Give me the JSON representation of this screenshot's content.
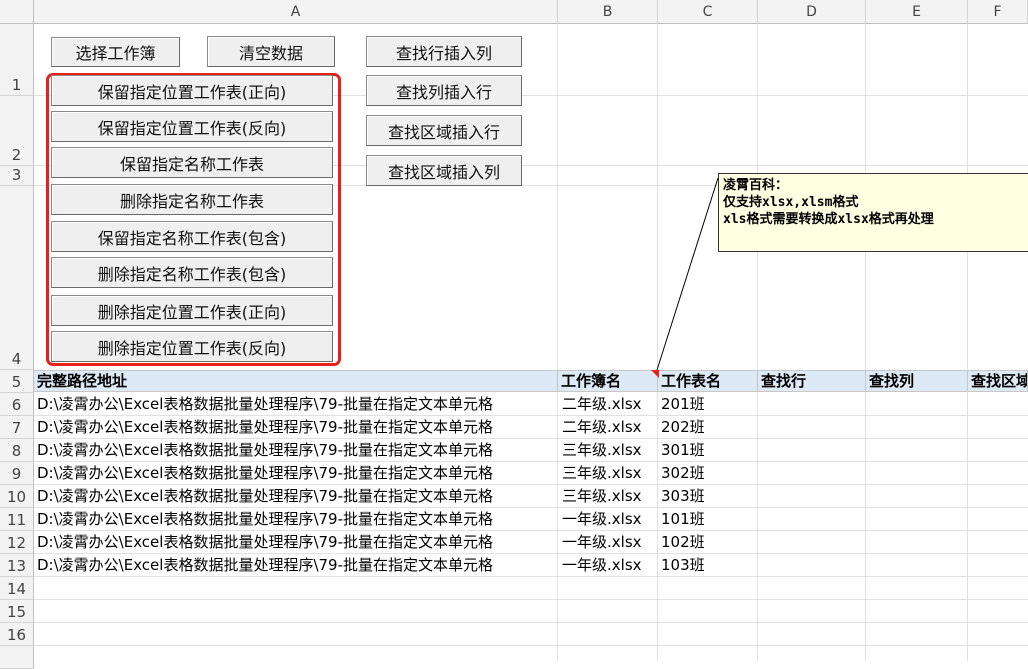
{
  "columns": [
    "A",
    "B",
    "C",
    "D",
    "E",
    "F"
  ],
  "rows": [
    "1",
    "2",
    "3",
    "4",
    "5",
    "6",
    "7",
    "8",
    "9",
    "10",
    "11",
    "12",
    "13",
    "14",
    "15",
    "16"
  ],
  "buttons": {
    "select_workbook": "选择工作簿",
    "clear_data": "清空数据",
    "find_row_insert_col": "查找行插入列",
    "find_col_insert_row": "查找列插入行",
    "find_area_insert_row": "查找区域插入行",
    "find_area_insert_col": "查找区域插入列",
    "group": [
      "保留指定位置工作表(正向)",
      "保留指定位置工作表(反向)",
      "保留指定名称工作表",
      "删除指定名称工作表",
      "保留指定名称工作表(包含)",
      "删除指定名称工作表(包含)",
      "删除指定位置工作表(正向)",
      "删除指定位置工作表(反向)"
    ]
  },
  "comment": {
    "line1": "凌霄百科：",
    "line2": "仅支持xlsx,xlsm格式",
    "line3": "xls格式需要转换成xlsx格式再处理"
  },
  "table": {
    "headers": [
      "完整路径地址",
      "工作簿名",
      "工作表名",
      "查找行",
      "查找列",
      "查找区域"
    ],
    "rows": [
      [
        "D:\\凌霄办公\\Excel表格数据批量处理程序\\79-批量在指定文本单元格",
        "二年级.xlsx",
        "201班"
      ],
      [
        "D:\\凌霄办公\\Excel表格数据批量处理程序\\79-批量在指定文本单元格",
        "二年级.xlsx",
        "202班"
      ],
      [
        "D:\\凌霄办公\\Excel表格数据批量处理程序\\79-批量在指定文本单元格",
        "三年级.xlsx",
        "301班"
      ],
      [
        "D:\\凌霄办公\\Excel表格数据批量处理程序\\79-批量在指定文本单元格",
        "三年级.xlsx",
        "302班"
      ],
      [
        "D:\\凌霄办公\\Excel表格数据批量处理程序\\79-批量在指定文本单元格",
        "三年级.xlsx",
        "303班"
      ],
      [
        "D:\\凌霄办公\\Excel表格数据批量处理程序\\79-批量在指定文本单元格",
        "一年级.xlsx",
        "101班"
      ],
      [
        "D:\\凌霄办公\\Excel表格数据批量处理程序\\79-批量在指定文本单元格",
        "一年级.xlsx",
        "102班"
      ],
      [
        "D:\\凌霄办公\\Excel表格数据批量处理程序\\79-批量在指定文本单元格",
        "一年级.xlsx",
        "103班"
      ]
    ]
  }
}
